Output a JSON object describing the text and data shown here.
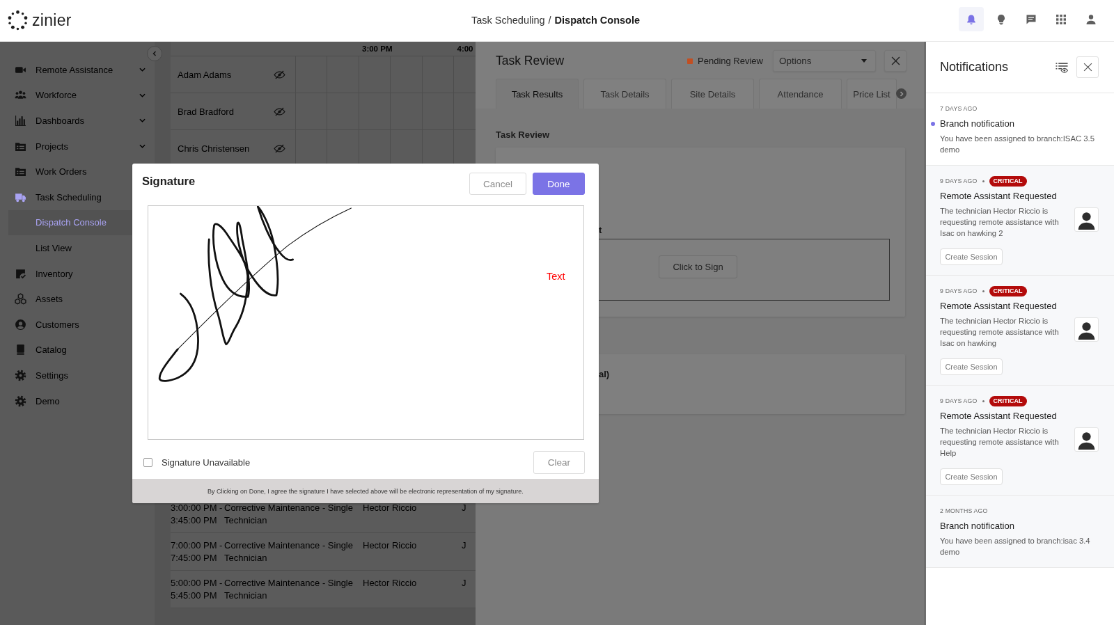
{
  "header": {
    "brand": "zinier",
    "breadcrumb": [
      {
        "label": "Task Scheduling",
        "current": false
      },
      {
        "label": "Dispatch Console",
        "current": true
      }
    ],
    "breadcrumb_separator": "/",
    "toolbar": [
      {
        "selected": true
      },
      {
        "selected": false
      },
      {
        "selected": false
      },
      {
        "selected": false
      },
      {
        "selected": false
      }
    ]
  },
  "sidebar": {
    "items": [
      {
        "label": "Remote Assistance",
        "expandable": true,
        "selected": false
      },
      {
        "label": "Workforce",
        "expandable": true,
        "selected": false
      },
      {
        "label": "Dashboards",
        "expandable": true,
        "selected": false
      },
      {
        "label": "Projects",
        "expandable": true,
        "selected": false
      },
      {
        "label": "Work Orders",
        "expandable": false,
        "selected": false
      },
      {
        "label": "Task Scheduling",
        "expandable": false,
        "selected": false,
        "children": [
          {
            "label": "Dispatch Console",
            "selected": true
          },
          {
            "label": "List View",
            "selected": false
          }
        ]
      },
      {
        "label": "Inventory",
        "expandable": false,
        "selected": false
      },
      {
        "label": "Assets",
        "expandable": false,
        "selected": false
      },
      {
        "label": "Customers",
        "expandable": false,
        "selected": false
      },
      {
        "label": "Catalog",
        "expandable": false,
        "selected": false
      },
      {
        "label": "Settings",
        "expandable": false,
        "selected": false
      },
      {
        "label": "Demo",
        "expandable": false,
        "selected": false
      }
    ]
  },
  "schedule": {
    "time_labels": [
      "3:00 PM",
      "4:00"
    ],
    "resources": [
      {
        "name": "Adam Adams"
      },
      {
        "name": "Brad Bradford"
      },
      {
        "name": "Chris Christensen"
      }
    ],
    "tasks": [
      {
        "time": "3:00:00 PM - 3:45:00 PM",
        "type": "Corrective Maintenance - Single Technician",
        "technician": "Hector Riccio",
        "column_4": "J"
      },
      {
        "time": "7:00:00 PM - 7:45:00 PM",
        "type": "Corrective Maintenance - Single Technician",
        "technician": "Hector Riccio",
        "column_4": "J"
      },
      {
        "time": "5:00:00 PM - 5:45:00 PM",
        "type": "Corrective Maintenance - Single Technician",
        "technician": "Hector Riccio",
        "column_4": "J"
      }
    ]
  },
  "task_review": {
    "title": "Task Review",
    "status": "Pending Review",
    "options": "Options",
    "tabs": [
      {
        "label": "Task Results",
        "selected": true
      },
      {
        "label": "Task Details",
        "selected": false
      },
      {
        "label": "Site Details",
        "selected": false
      },
      {
        "label": "Attendance",
        "selected": false
      },
      {
        "label": "Price List",
        "selected": false
      }
    ],
    "section_label": "Task Review",
    "signature_card": {
      "label": "t",
      "button": "Click to Sign"
    },
    "next_card": {
      "label": "al)"
    }
  },
  "notifications": {
    "title": "Notifications",
    "items": [
      {
        "kind": "branch",
        "time": "7 DAYS AGO",
        "unread": true,
        "title": "Branch notification",
        "text": "You have been assigned to branch:ISAC 3.5 demo"
      },
      {
        "kind": "assist_request",
        "time": "9 DAYS AGO",
        "badge": "CRITICAL",
        "unread": false,
        "title": "Remote Assistant Requested",
        "text": "The technician Hector Riccio is requesting remote assistance with Isac on hawking 2",
        "action": "Create Session"
      },
      {
        "kind": "assist_request",
        "time": "9 DAYS AGO",
        "badge": "CRITICAL",
        "unread": false,
        "title": "Remote Assistant Requested",
        "text": "The technician Hector Riccio is requesting remote assistance with Isac on hawking",
        "action": "Create Session"
      },
      {
        "kind": "assist_request",
        "time": "9 DAYS AGO",
        "badge": "CRITICAL",
        "unread": false,
        "title": "Remote Assistant Requested",
        "text": "The technician Hector Riccio is requesting remote assistance with Help",
        "action": "Create Session"
      },
      {
        "kind": "branch",
        "time": "2 MONTHS AGO",
        "unread": false,
        "title": "Branch notification",
        "text": "You have been assigned to branch:isac 3.4 demo"
      }
    ]
  },
  "signature_dialog": {
    "title": "Signature",
    "cancel": "Cancel",
    "done": "Done",
    "pad_text": "Text",
    "unavailable": {
      "label": "Signature Unavailable",
      "checked": false
    },
    "clear": "Clear",
    "disclaimer": "By Clicking on Done, I agree the signature I have selected above will be electronic representation of my signature."
  }
}
